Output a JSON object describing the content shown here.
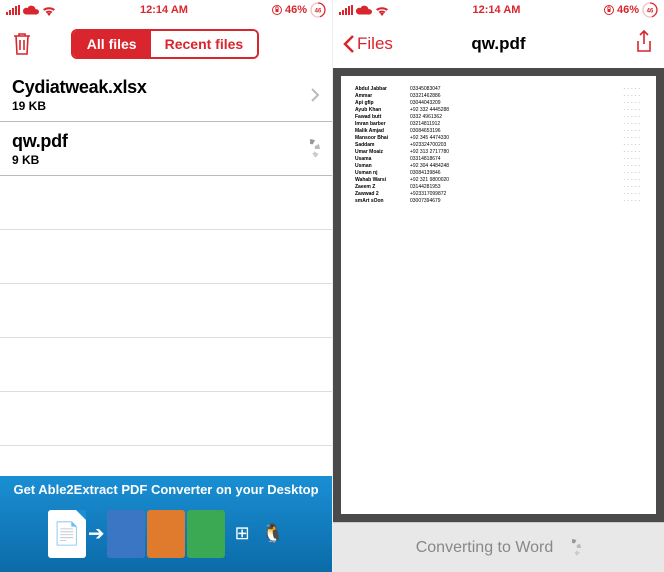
{
  "status": {
    "time": "12:14 AM",
    "battery_pct": "46%",
    "battery_ring": "46"
  },
  "left": {
    "tabs": {
      "all": "All files",
      "recent": "Recent files"
    },
    "files": [
      {
        "name": "Cydiatweak.xlsx",
        "size": "19 KB"
      },
      {
        "name": "qw.pdf",
        "size": "9 KB"
      }
    ],
    "promo": "Get Able2Extract PDF Converter on your Desktop"
  },
  "right": {
    "back": "Files",
    "title": "qw.pdf",
    "converting": "Converting to Word",
    "rows": [
      {
        "n": "Abdul Jabbar",
        "p": "03345083047"
      },
      {
        "n": "Ammar",
        "p": "03321462886"
      },
      {
        "n": "Api gfip",
        "p": "03044043209"
      },
      {
        "n": "Ayub Khan",
        "p": "+92 332 4445288"
      },
      {
        "n": "Fawad butt",
        "p": "0332 4961362"
      },
      {
        "n": "Imran barber",
        "p": "03214811912"
      },
      {
        "n": "Malik Amjad",
        "p": "03084653196"
      },
      {
        "n": "Mansoor Bhai",
        "p": "+92 345 4474330"
      },
      {
        "n": "Saddam",
        "p": "+923324700203"
      },
      {
        "n": "Umar Moaiz",
        "p": "+92 313 2717780"
      },
      {
        "n": "Usama",
        "p": "03314818674"
      },
      {
        "n": "Usman",
        "p": "+92 304 4484248"
      },
      {
        "n": "Usman nj",
        "p": "03084139846"
      },
      {
        "n": "Wahab Warsi",
        "p": "+92 321 9800020"
      },
      {
        "n": "Zaeem Z",
        "p": "03144281953"
      },
      {
        "n": "Zawwad 2",
        "p": "+923317099872"
      },
      {
        "n": "smArt sOon",
        "p": "03007394679"
      }
    ]
  }
}
